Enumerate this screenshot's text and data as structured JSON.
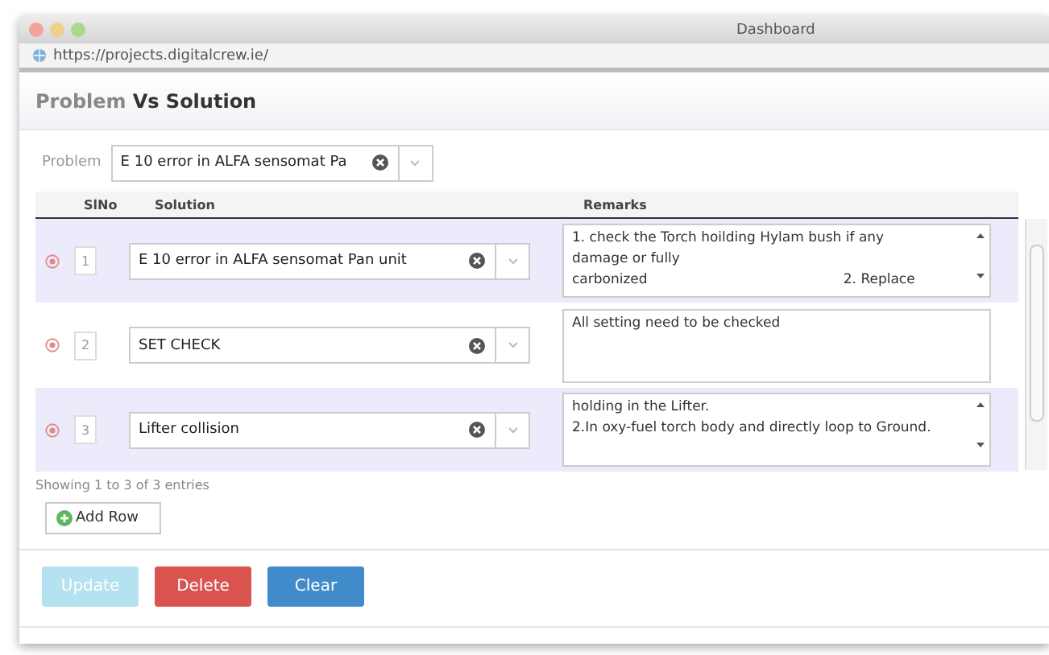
{
  "window": {
    "title": "Dashboard",
    "url": "https://projects.digitalcrew.ie/"
  },
  "page_title": {
    "light": "Problem",
    "bold": "Vs Solution"
  },
  "problem": {
    "label": "Problem",
    "value": "E 10 error in ALFA sensomat Pa"
  },
  "table": {
    "columns": [
      "SlNo",
      "Solution",
      "Remarks"
    ],
    "rows": [
      {
        "sl": "1",
        "solution": "E 10 error in ALFA sensomat Pan unit",
        "remarks": [
          "1. check the Torch hoilding Hylam bush if any",
          "damage or fully",
          "carbonized                                             2. Replace"
        ],
        "scrollable": true
      },
      {
        "sl": "2",
        "solution": "SET CHECK",
        "remarks": [
          "All setting need to be checked"
        ],
        "scrollable": false
      },
      {
        "sl": "3",
        "solution": "Lifter collision",
        "remarks": [
          "holding in the Lifter.",
          "2.In oxy-fuel torch body and directly loop to Ground."
        ],
        "scrollable": true
      }
    ]
  },
  "info": "Showing 1 to 3 of 3 entries",
  "add_row": "Add Row",
  "buttons": [
    {
      "label": "Update",
      "kind": "update",
      "disabled": true
    },
    {
      "label": "Delete",
      "kind": "delete",
      "disabled": false
    },
    {
      "label": "Clear",
      "kind": "clear",
      "disabled": false
    }
  ]
}
